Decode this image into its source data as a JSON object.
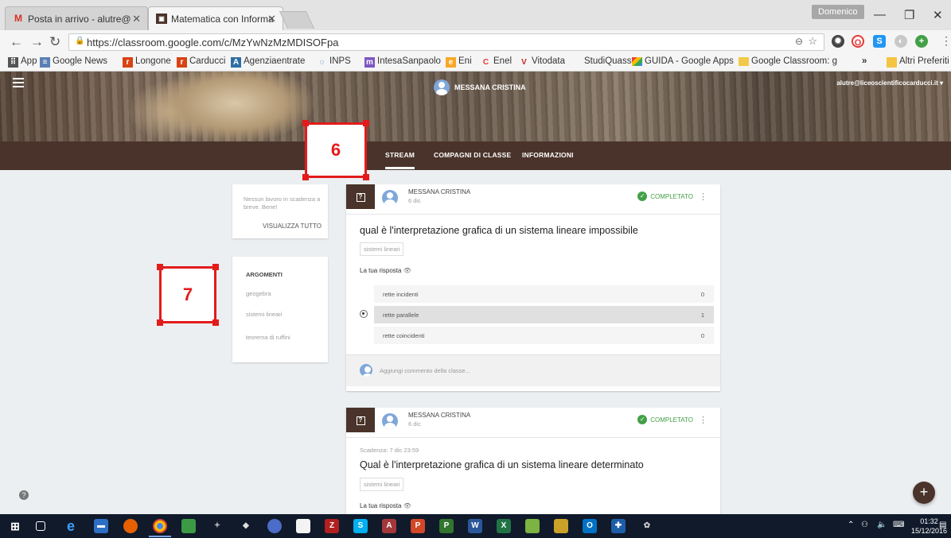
{
  "browser": {
    "tabs": [
      {
        "title": "Posta in arrivo - alutre@",
        "icon": "gmail-icon"
      },
      {
        "title": "Matematica con Informa",
        "icon": "classroom-icon"
      }
    ],
    "window_user": "Domenico",
    "url": "https://classroom.google.com/c/MzYwNzMzMDISOFpa",
    "bookmarks": [
      {
        "label": "App",
        "icon": "apps-grid-icon",
        "color": "#555555"
      },
      {
        "label": "Google News",
        "icon": "news-icon",
        "color": "#5b7fb5"
      },
      {
        "label": "Longone",
        "icon": "registro-icon",
        "color": "#d84315"
      },
      {
        "label": "Carducci",
        "icon": "registro-icon",
        "color": "#d84315"
      },
      {
        "label": "Agenziaentrate",
        "icon": "agenzia-icon",
        "color": "#2e6da4"
      },
      {
        "label": "INPS",
        "icon": "inps-icon",
        "color": "#1e5aa8"
      },
      {
        "label": "IntesaSanpaolo",
        "icon": "intesa-icon",
        "color": "#7e57c2"
      },
      {
        "label": "Eni",
        "icon": "eni-icon",
        "color": "#f9a825"
      },
      {
        "label": "Enel",
        "icon": "enel-icon",
        "color": "#e53935"
      },
      {
        "label": "Vitodata",
        "icon": "vitodata-icon",
        "color": "#c62828"
      },
      {
        "label": "StudiQuasso",
        "icon": "page-icon",
        "color": "#9e9e9e"
      },
      {
        "label": "GUIDA - Google Apps",
        "icon": "gsuite-icon",
        "color": "#fbbc05"
      },
      {
        "label": "Google Classroom: gu",
        "icon": "classroom-icon",
        "color": "#f2c94c"
      }
    ],
    "bookmarks_overflow": "»",
    "other_bookmarks": "Altri Preferiti"
  },
  "classroom": {
    "teacher_name": "MESSANA CRISTINA",
    "account": "alutre@liceoscientificocarducci.it",
    "nav_tabs": [
      "STREAM",
      "COMPAGNI DI CLASSE",
      "INFORMAZIONI"
    ],
    "upcoming": {
      "text": "Nessun lavoro in scadenza a breve. Bene!",
      "link": "VISUALIZZA TUTTO"
    },
    "topics": {
      "heading": "ARGOMENTI",
      "items": [
        "geogebra",
        "sistemi lineari",
        "teorema di ruffini"
      ]
    },
    "posts": [
      {
        "author": "MESSANA CRISTINA",
        "date": "6 dic",
        "status": "COMPLETATO",
        "title": "qual è l'interpretazione grafica di un sistema lineare impossibile",
        "tag": "sistemi lineari",
        "answer_label": "La tua risposta",
        "options": [
          {
            "label": "rette incidenti",
            "count": "0",
            "selected": false
          },
          {
            "label": "rette parallele",
            "count": "1",
            "selected": true
          },
          {
            "label": "rette coincidenti",
            "count": "0",
            "selected": false
          }
        ],
        "comment_placeholder": "Aggiungi commento della classe..."
      },
      {
        "author": "MESSANA CRISTINA",
        "date": "6 dic",
        "status": "COMPLETATO",
        "due": "Scadenza: 7 dic 23:59",
        "title": "Qual è l'interpretazione grafica di un sistema lineare determinato",
        "tag": "sistemi lineari",
        "answer_label": "La tua risposta"
      }
    ]
  },
  "annotations": [
    "6",
    "7"
  ],
  "taskbar": {
    "apps": [
      "windows-start-icon",
      "task-view-icon",
      "edge-icon",
      "file-explorer-icon",
      "firefox-icon",
      "chrome-icon",
      "app-icon",
      "app-icon",
      "app-icon",
      "app-icon",
      "app-icon",
      "filezilla-icon",
      "skype-icon",
      "access-icon",
      "powerpoint-icon",
      "project-icon",
      "word-icon",
      "excel-icon",
      "app-icon",
      "app-icon",
      "outlook-icon",
      "app-icon",
      "app-icon"
    ],
    "time": "01:32",
    "date": "15/12/2016"
  },
  "colors": {
    "brown": "#4a332a",
    "complete_green": "#43a047",
    "annotation_red": "#e31b1b"
  }
}
